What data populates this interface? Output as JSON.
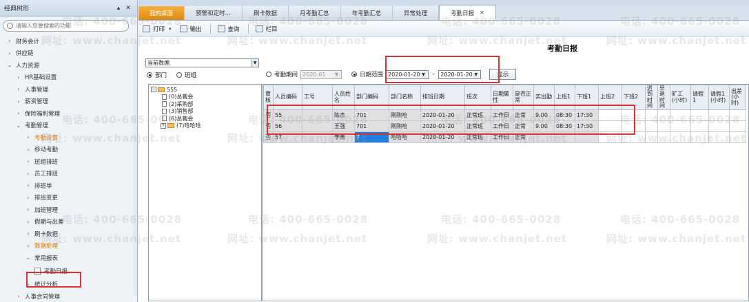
{
  "sidebar": {
    "title": "经典树形",
    "pin_glyph": "▴",
    "close_glyph": "✕",
    "search_placeholder": "请输入您要搜索的功能",
    "items": [
      {
        "label": "财务会计",
        "level": 0,
        "arrow": "›"
      },
      {
        "label": "供应链",
        "level": 0,
        "arrow": "›"
      },
      {
        "label": "人力资源",
        "level": 0,
        "arrow": "⌄"
      },
      {
        "label": "HR基础设置",
        "level": 1,
        "arrow": "›"
      },
      {
        "label": "人事管理",
        "level": 1,
        "arrow": "›"
      },
      {
        "label": "薪资管理",
        "level": 1,
        "arrow": "›"
      },
      {
        "label": "保险福利管理",
        "level": 1,
        "arrow": "›"
      },
      {
        "label": "考勤管理",
        "level": 1,
        "arrow": "⌄"
      },
      {
        "label": "考勤设置",
        "level": 2,
        "arrow": "›",
        "highlight": true
      },
      {
        "label": "移动考勤",
        "level": 2,
        "arrow": "›"
      },
      {
        "label": "班组排班",
        "level": 2,
        "arrow": "›"
      },
      {
        "label": "员工排班",
        "level": 2,
        "arrow": "›"
      },
      {
        "label": "排班单",
        "level": 2,
        "arrow": "›"
      },
      {
        "label": "排班变更",
        "level": 2,
        "arrow": "›"
      },
      {
        "label": "加班管理",
        "level": 2,
        "arrow": "›"
      },
      {
        "label": "假期与出差",
        "level": 2,
        "arrow": "›"
      },
      {
        "label": "刷卡数据",
        "level": 2,
        "arrow": "›"
      },
      {
        "label": "数据处理",
        "level": 2,
        "arrow": "›",
        "highlight": true
      },
      {
        "label": "常用报表",
        "level": 2,
        "arrow": "⌄"
      }
    ],
    "selected_item": "考勤日报",
    "after_items": [
      {
        "label": "统计分析",
        "level": 2,
        "arrow": "›"
      },
      {
        "label": "人事合同管理",
        "level": 1,
        "arrow": "›"
      }
    ]
  },
  "tabs": [
    {
      "label": "我的桌面",
      "type": "home"
    },
    {
      "label": "预警和定时…",
      "type": "normal"
    },
    {
      "label": "刷卡数据",
      "type": "normal"
    },
    {
      "label": "月考勤汇总",
      "type": "normal"
    },
    {
      "label": "年考勤汇总",
      "type": "normal"
    },
    {
      "label": "异常处理",
      "type": "normal"
    },
    {
      "label": "考勤日报",
      "type": "active",
      "close": "✕"
    }
  ],
  "toolbar": {
    "print": "打印",
    "export": "输出",
    "query": "查询",
    "columns": "栏目"
  },
  "report": {
    "title": "考勤日报",
    "data_scope": "当前数据",
    "radio_dept": "部门",
    "radio_group": "班组",
    "period_label": "考勤期间",
    "period_value": "2020-01",
    "range_label": "日期范围",
    "date_from": "2020-01-20",
    "dash": "–",
    "date_to": "2020-01-20",
    "show_button": "显示"
  },
  "org_tree": {
    "root": "555",
    "children": [
      {
        "label": "(0)总裁会",
        "type": "file"
      },
      {
        "label": "(2)采购部",
        "type": "file"
      },
      {
        "label": "(3)销售部",
        "type": "file"
      },
      {
        "label": "(6)总裁会",
        "type": "file"
      },
      {
        "label": "(7)哈哈哈",
        "type": "folder"
      }
    ]
  },
  "grid": {
    "columns": [
      "审核",
      "人员编码",
      "工号",
      "人员姓名",
      "部门编码",
      "部门名称",
      "排班日期",
      "班次",
      "日期属性",
      "是否正常",
      "实出勤",
      "上班1",
      "下班1",
      "上班2",
      "下班2",
      "迟到时间",
      "早退时间",
      "旷工(小时)",
      "请假1",
      "请假1(小时)",
      "出差(小时)"
    ],
    "rows": [
      [
        "否",
        "55",
        "",
        "陈杰",
        "701",
        "刚刚哈",
        "2020-01-20",
        "正常班",
        "工作日",
        "正常",
        "9.00",
        "08:30",
        "17:30",
        "",
        "",
        "",
        "",
        "",
        "",
        "",
        ""
      ],
      [
        "否",
        "56",
        "",
        "王强",
        "701",
        "刚刚哈",
        "2020-01-20",
        "正常班",
        "工作日",
        "正常",
        "9.00",
        "08:30",
        "17:30",
        "",
        "",
        "",
        "",
        "",
        "",
        "",
        ""
      ],
      [
        "否",
        "57",
        "",
        "李燕",
        "7",
        "哈哈哈",
        "2020-01-20",
        "正常班",
        "工作日",
        "正常",
        "",
        "",
        "",
        "",
        "",
        "",
        "",
        "",
        "",
        "",
        ""
      ]
    ]
  },
  "watermark": {
    "phone": "电话: 400-665-0028",
    "site": "网址: www.chanjet.net"
  }
}
